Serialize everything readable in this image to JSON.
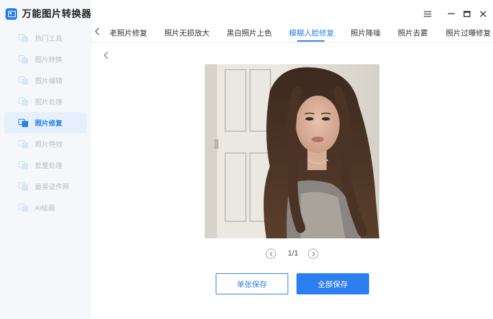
{
  "app": {
    "title": "万能图片转换器"
  },
  "sidebar": {
    "items": [
      {
        "label": "热门工具",
        "icon": "hot-tools-icon"
      },
      {
        "label": "图片转换",
        "icon": "image-convert-icon"
      },
      {
        "label": "图片编辑",
        "icon": "image-edit-icon"
      },
      {
        "label": "图片处理",
        "icon": "image-process-icon"
      },
      {
        "label": "照片修复",
        "icon": "photo-repair-icon",
        "active": true
      },
      {
        "label": "照片特效",
        "icon": "photo-effects-icon"
      },
      {
        "label": "批量处理",
        "icon": "batch-process-icon"
      },
      {
        "label": "最美证件照",
        "icon": "id-photo-icon"
      },
      {
        "label": "AI绘画",
        "icon": "ai-painting-icon"
      }
    ]
  },
  "tabs": {
    "items": [
      {
        "label": "老照片修复"
      },
      {
        "label": "照片无损放大"
      },
      {
        "label": "黑白照片上色"
      },
      {
        "label": "模糊人脸修复",
        "active": true
      },
      {
        "label": "照片降噪"
      },
      {
        "label": "照片去雾"
      },
      {
        "label": "照片过曝修复"
      }
    ]
  },
  "pager": {
    "text": "1/1"
  },
  "actions": {
    "save_single": "单张保存",
    "save_all": "全部保存"
  },
  "colors": {
    "accent": "#2b7ff0",
    "sidebar_bg": "#f5f7fa",
    "active_bg": "#e6f0fd"
  }
}
